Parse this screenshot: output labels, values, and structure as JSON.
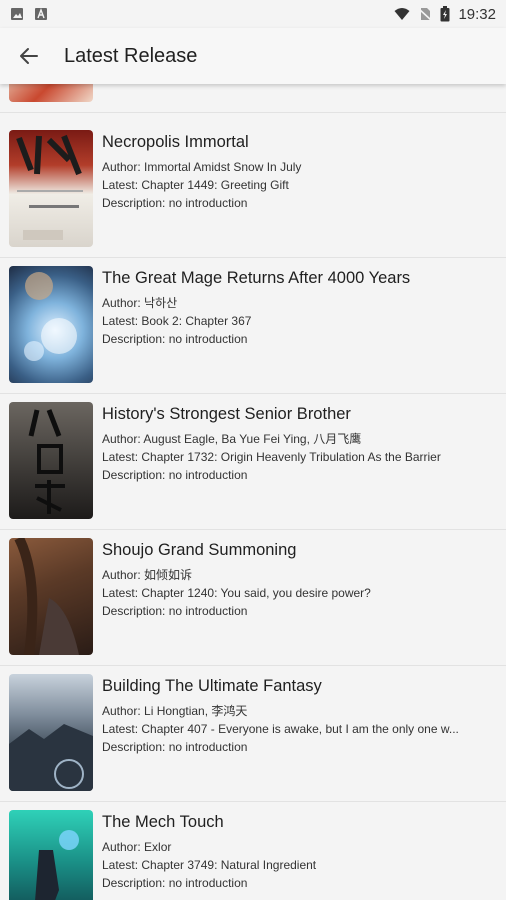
{
  "status_bar": {
    "time": "19:32",
    "left_icons": [
      "image-icon",
      "text-icon"
    ],
    "right_icons": [
      "wifi-icon",
      "no-sim-icon",
      "battery-icon"
    ]
  },
  "app_bar": {
    "title": "Latest Release",
    "back_icon": "arrow-back-icon"
  },
  "books": [
    {
      "title": "Necropolis Immortal",
      "author": "Author: Immortal Amidst Snow In July",
      "latest": "Latest: Chapter 1449: Greeting Gift",
      "description": "Description: no introduction"
    },
    {
      "title": "The Great Mage Returns After 4000 Years",
      "author": "Author: 낙하산",
      "latest": "Latest: Book 2: Chapter 367",
      "description": "Description: no introduction"
    },
    {
      "title": "History's Strongest Senior Brother",
      "author": "Author: August Eagle, Ba Yue Fei Ying, 八月飞鹰",
      "latest": "Latest: Chapter 1732: Origin Heavenly Tribulation As the Barrier",
      "description": "Description: no introduction"
    },
    {
      "title": "Shoujo Grand Summoning",
      "author": "Author: 如倾如诉",
      "latest": "Latest: Chapter 1240: You said, you desire power?",
      "description": "Description: no introduction"
    },
    {
      "title": "Building The Ultimate Fantasy",
      "author": "Author: Li Hongtian, 李鸿天",
      "latest": "Latest: Chapter 407 - Everyone is awake, but I am the only one w...",
      "description": "Description: no introduction"
    },
    {
      "title": "The Mech Touch",
      "author": "Author: Exlor",
      "latest": "Latest: Chapter 3749: Natural Ingredient",
      "description": "Description: no introduction"
    }
  ]
}
